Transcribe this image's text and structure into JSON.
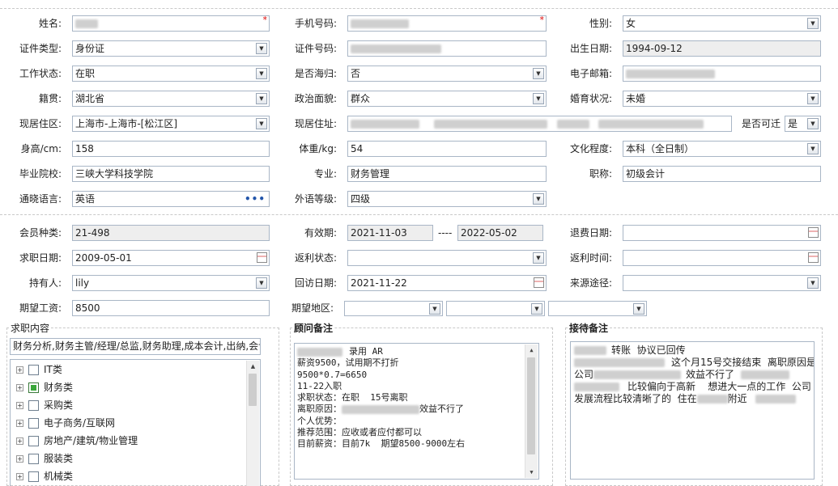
{
  "form": {
    "name_label": "姓名:",
    "mobile_label": "手机号码:",
    "gender_label": "性别:",
    "gender_value": "女",
    "id_type_label": "证件类型:",
    "id_type_value": "身份证",
    "id_no_label": "证件号码:",
    "birth_label": "出生日期:",
    "birth_value": "1994-09-12",
    "work_status_label": "工作状态:",
    "work_status_value": "在职",
    "returnee_label": "是否海归:",
    "returnee_value": "否",
    "email_label": "电子邮箱:",
    "native_label": "籍贯:",
    "native_value": "湖北省",
    "political_label": "政治面貌:",
    "political_value": "群众",
    "marital_label": "婚育状况:",
    "marital_value": "未婚",
    "residence_area_label": "现居住区:",
    "residence_area_value": "上海市-上海市-[松江区]",
    "address_label": "现居住址:",
    "relocate_label": "是否可迁",
    "relocate_value": "是",
    "height_label": "身高/cm:",
    "height_value": "158",
    "weight_label": "体重/kg:",
    "weight_value": "54",
    "education_label": "文化程度:",
    "education_value": "本科（全日制）",
    "school_label": "毕业院校:",
    "school_value": "三峡大学科技学院",
    "major_label": "专业:",
    "major_value": "财务管理",
    "title_label": "职称:",
    "title_value": "初级会计",
    "language_label": "通晓语言:",
    "language_value": "英语",
    "foreign_level_label": "外语等级:",
    "foreign_level_value": "四级",
    "member_type_label": "会员种类:",
    "member_type_value": "21-498",
    "valid_label": "有效期:",
    "valid_from": "2021-11-03",
    "valid_sep": "----",
    "valid_to": "2022-05-02",
    "refund_date_label": "退费日期:",
    "job_date_label": "求职日期:",
    "job_date_value": "2009-05-01",
    "rebate_status_label": "返利状态:",
    "rebate_time_label": "返利时间:",
    "holder_label": "持有人:",
    "holder_value": "lily",
    "visit_date_label": "回访日期:",
    "visit_date_value": "2021-11-22",
    "source_label": "来源途径:",
    "salary_label": "期望工资:",
    "salary_value": "8500",
    "region_label": "期望地区:",
    "required_mark": "*",
    "dropdown_glyph": "▼",
    "ellipsis_glyph": "•••"
  },
  "job_panel": {
    "title": "求职内容",
    "summary": "财务分析,财务主管/经理/总监,财务助理,成本会计,出纳,会计",
    "tree": [
      {
        "label": "IT类",
        "checked": false
      },
      {
        "label": "财务类",
        "checked": true
      },
      {
        "label": "采购类",
        "checked": false
      },
      {
        "label": "电子商务/互联网",
        "checked": false
      },
      {
        "label": "房地产/建筑/物业管理",
        "checked": false
      },
      {
        "label": "服装类",
        "checked": false
      },
      {
        "label": "机械类",
        "checked": false
      }
    ]
  },
  "advisor_panel": {
    "title": "顾问备注",
    "lines": [
      "录用 AR",
      "薪资9500，试用期不打折",
      "9500*0.7=6650",
      "11-22入职",
      "",
      "求职状态：在职  15号离职",
      "离职原因：",
      "个人优势：",
      "推荐范围：应收或者应付都可以",
      "目前薪资：目前7k  期望8500-9000左右"
    ],
    "reason_tail": "效益不行了"
  },
  "reception_panel": {
    "title": "接待备注",
    "line1": "转账  协议已回传",
    "line2a": "这个月15号交接结束  离职原因是",
    "line3a": "公司",
    "line3b": "效益不行了",
    "line4": "比较偏向于高新    想进大一点的工作  公司",
    "line5a": "发展流程比较清晰了的  住在",
    "line5b": "附近"
  }
}
